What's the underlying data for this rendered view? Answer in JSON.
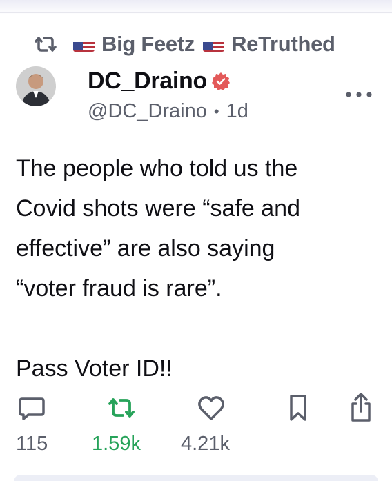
{
  "retruth": {
    "user_name": "Big Feetz",
    "action": "ReTruthed"
  },
  "post": {
    "display_name": "DC_Draino",
    "handle": "@DC_Draino",
    "separator": "•",
    "age": "1d",
    "text": "The people who told us the\nCovid shots were “safe and\neffective” are also saying\n“voter fraud is rare”.\n\nPass Voter ID!!"
  },
  "actions": {
    "replies": "115",
    "retruths": "1.59k",
    "likes": "4.21k"
  },
  "icons": {
    "retruth": "retruth-icon",
    "flag": "us-flag-icon",
    "verified": "verified-badge-icon",
    "more": "more-icon",
    "reply": "reply-icon",
    "like": "heart-icon",
    "bookmark": "bookmark-icon",
    "share": "share-icon"
  },
  "colors": {
    "text": "#0f0f14",
    "muted": "#5b5f6b",
    "retruth_active": "#27a35a",
    "verified": "#e35a5a"
  }
}
